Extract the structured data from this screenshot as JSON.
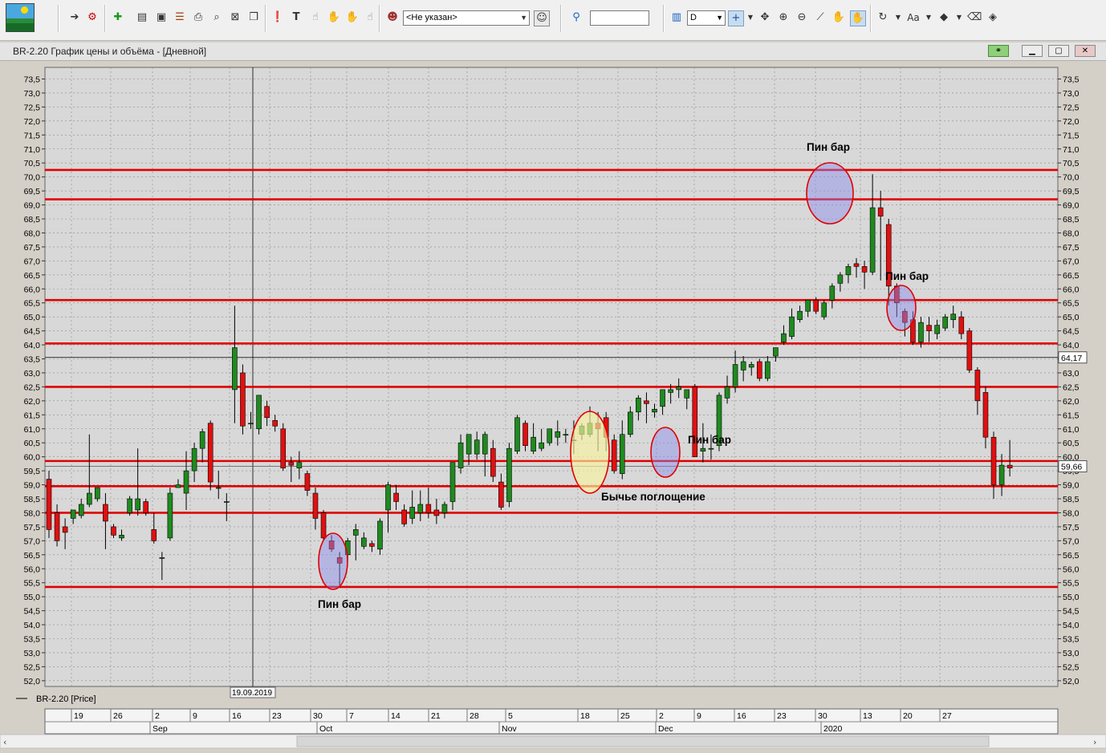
{
  "toolbar": {
    "instrument_select": "<Не указан>",
    "period_select": "D",
    "icons": [
      "logo-icon",
      "arrow-right-icon",
      "chart-settings-icon",
      "add-window-icon",
      "window-icon",
      "window-icon",
      "table-icon",
      "print-icon",
      "search-icon",
      "close-window-icon",
      "copy-icon",
      "info-icon",
      "text-tool-icon",
      "hand-icon",
      "hand-icon",
      "hand-icon",
      "hand-icon",
      "user-icon",
      "user-search-icon",
      "search-icon",
      "chart-type-icon",
      "crosshair-icon",
      "move-icon",
      "zoom-in-icon",
      "zoom-out-icon",
      "ruler-icon",
      "pan-icon",
      "pan-icon",
      "rotate-icon",
      "font-icon",
      "color-icon",
      "eraser-icon",
      "layers-icon"
    ]
  },
  "window": {
    "title": "BR-2.20 График цены и объёма - [Дневной]"
  },
  "chart_data": {
    "type": "candlestick",
    "instrument": "BR-2.20 [Price]",
    "y_ticks": [
      "73,5",
      "73,0",
      "72,5",
      "72,0",
      "71,5",
      "71,0",
      "70,5",
      "70,0",
      "69,5",
      "69,0",
      "68,5",
      "68,0",
      "67,5",
      "67,0",
      "66,5",
      "66,0",
      "65,5",
      "65,0",
      "64,5",
      "64,0",
      "63,5",
      "63,0",
      "62,5",
      "62,0",
      "61,5",
      "61,0",
      "60,5",
      "60,0",
      "59,5",
      "59,0",
      "58,5",
      "58,0",
      "57,5",
      "57,0",
      "56,5",
      "56,0",
      "55,5",
      "55,0",
      "54,5",
      "54,0",
      "53,5",
      "53,0",
      "52,5",
      "52,0"
    ],
    "ylim": [
      51.8,
      73.7
    ],
    "x_day_ticks": [
      "19",
      "26",
      "2",
      "9",
      "16",
      "23",
      "30",
      "7",
      "14",
      "21",
      "28",
      "5",
      "18",
      "25",
      "2",
      "9",
      "16",
      "23",
      "30",
      "13",
      "20",
      "27"
    ],
    "x_month_labels": [
      "Sep",
      "Oct",
      "Nov",
      "Dec",
      "2020"
    ],
    "crosshair_date": "19.09.2019",
    "price_labels": [
      "64,17",
      "59,66"
    ],
    "support_resistance_levels": [
      70.25,
      69.2,
      65.6,
      64.05,
      62.5,
      59.85,
      58.95,
      58.0,
      55.35
    ],
    "crosshair_price_level": 63.55,
    "current_price_level": 59.66,
    "annotations": [
      "Пин бар",
      "Пин бар",
      "Пин бар",
      "Пин бар",
      "Бычье поглощение"
    ],
    "candles": [
      {
        "o": 59.2,
        "h": 59.5,
        "l": 57.1,
        "c": 57.4
      },
      {
        "o": 58.0,
        "h": 58.3,
        "l": 56.8,
        "c": 57.0
      },
      {
        "o": 57.5,
        "h": 57.8,
        "l": 56.7,
        "c": 57.3
      },
      {
        "o": 57.8,
        "h": 58.1,
        "l": 57.6,
        "c": 58.1
      },
      {
        "o": 57.9,
        "h": 58.5,
        "l": 57.8,
        "c": 58.3
      },
      {
        "o": 58.3,
        "h": 60.8,
        "l": 58.2,
        "c": 58.7
      },
      {
        "o": 58.5,
        "h": 58.9,
        "l": 58.4,
        "c": 58.9
      },
      {
        "o": 58.3,
        "h": 58.7,
        "l": 56.7,
        "c": 57.7
      },
      {
        "o": 57.5,
        "h": 57.6,
        "l": 57.1,
        "c": 57.2
      },
      {
        "o": 57.1,
        "h": 57.4,
        "l": 57.0,
        "c": 57.2
      },
      {
        "o": 58.0,
        "h": 58.6,
        "l": 57.9,
        "c": 58.5
      },
      {
        "o": 58.1,
        "h": 60.3,
        "l": 57.9,
        "c": 58.5
      },
      {
        "o": 58.4,
        "h": 58.5,
        "l": 57.9,
        "c": 58.0
      },
      {
        "o": 57.4,
        "h": 58.0,
        "l": 56.9,
        "c": 57.0
      },
      {
        "o": 56.4,
        "h": 56.6,
        "l": 55.6,
        "c": 56.4
      },
      {
        "o": 57.1,
        "h": 58.9,
        "l": 57.0,
        "c": 58.7
      },
      {
        "o": 58.9,
        "h": 59.2,
        "l": 58.9,
        "c": 59.0
      },
      {
        "o": 58.7,
        "h": 60.2,
        "l": 58.1,
        "c": 59.5
      },
      {
        "o": 59.5,
        "h": 60.5,
        "l": 59.1,
        "c": 60.3
      },
      {
        "o": 60.3,
        "h": 61.0,
        "l": 59.8,
        "c": 60.9
      },
      {
        "o": 61.2,
        "h": 61.3,
        "l": 58.8,
        "c": 59.1
      },
      {
        "o": 58.9,
        "h": 59.5,
        "l": 58.5,
        "c": 58.9
      },
      {
        "o": 58.4,
        "h": 58.7,
        "l": 57.7,
        "c": 58.4
      },
      {
        "o": 62.4,
        "h": 65.4,
        "l": 61.2,
        "c": 63.9
      },
      {
        "o": 63.0,
        "h": 63.3,
        "l": 60.8,
        "c": 61.1
      },
      {
        "o": 61.2,
        "h": 61.6,
        "l": 61.0,
        "c": 61.2
      },
      {
        "o": 61.0,
        "h": 62.2,
        "l": 60.8,
        "c": 62.2
      },
      {
        "o": 61.8,
        "h": 62.0,
        "l": 61.1,
        "c": 61.4
      },
      {
        "o": 61.3,
        "h": 61.5,
        "l": 60.9,
        "c": 61.1
      },
      {
        "o": 61.0,
        "h": 61.2,
        "l": 59.5,
        "c": 59.6
      },
      {
        "o": 59.8,
        "h": 60.0,
        "l": 59.1,
        "c": 59.7
      },
      {
        "o": 59.6,
        "h": 60.2,
        "l": 59.2,
        "c": 59.8
      },
      {
        "o": 59.4,
        "h": 59.5,
        "l": 58.6,
        "c": 58.8
      },
      {
        "o": 58.7,
        "h": 58.9,
        "l": 57.4,
        "c": 57.8
      },
      {
        "o": 58.0,
        "h": 58.1,
        "l": 57.0,
        "c": 57.1
      },
      {
        "o": 57.0,
        "h": 57.2,
        "l": 56.6,
        "c": 56.7
      },
      {
        "o": 56.4,
        "h": 56.6,
        "l": 55.4,
        "c": 56.2
      },
      {
        "o": 56.5,
        "h": 57.1,
        "l": 56.3,
        "c": 57.0
      },
      {
        "o": 57.2,
        "h": 57.6,
        "l": 56.3,
        "c": 57.4
      },
      {
        "o": 56.8,
        "h": 57.3,
        "l": 56.7,
        "c": 57.1
      },
      {
        "o": 56.9,
        "h": 57.0,
        "l": 56.6,
        "c": 56.8
      },
      {
        "o": 56.7,
        "h": 57.8,
        "l": 56.5,
        "c": 57.7
      },
      {
        "o": 58.1,
        "h": 59.1,
        "l": 57.3,
        "c": 59.0
      },
      {
        "o": 58.7,
        "h": 59.0,
        "l": 58.1,
        "c": 58.4
      },
      {
        "o": 58.1,
        "h": 58.3,
        "l": 57.5,
        "c": 57.6
      },
      {
        "o": 57.8,
        "h": 58.8,
        "l": 57.6,
        "c": 58.2
      },
      {
        "o": 58.0,
        "h": 58.8,
        "l": 57.7,
        "c": 58.3
      },
      {
        "o": 58.3,
        "h": 58.9,
        "l": 57.8,
        "c": 58.0
      },
      {
        "o": 58.1,
        "h": 58.5,
        "l": 57.6,
        "c": 57.9
      },
      {
        "o": 58.0,
        "h": 58.4,
        "l": 57.8,
        "c": 58.3
      },
      {
        "o": 58.4,
        "h": 59.8,
        "l": 58.1,
        "c": 59.8
      },
      {
        "o": 59.6,
        "h": 60.8,
        "l": 59.4,
        "c": 60.5
      },
      {
        "o": 60.1,
        "h": 60.8,
        "l": 59.7,
        "c": 60.8
      },
      {
        "o": 60.1,
        "h": 60.9,
        "l": 59.9,
        "c": 60.6
      },
      {
        "o": 60.1,
        "h": 60.9,
        "l": 59.3,
        "c": 60.8
      },
      {
        "o": 60.3,
        "h": 60.6,
        "l": 59.1,
        "c": 59.3
      },
      {
        "o": 59.1,
        "h": 59.4,
        "l": 58.1,
        "c": 58.2
      },
      {
        "o": 58.4,
        "h": 60.5,
        "l": 58.2,
        "c": 60.3
      },
      {
        "o": 60.2,
        "h": 61.5,
        "l": 60.1,
        "c": 61.4
      },
      {
        "o": 61.2,
        "h": 61.3,
        "l": 60.2,
        "c": 60.4
      },
      {
        "o": 60.2,
        "h": 61.2,
        "l": 60.1,
        "c": 60.7
      },
      {
        "o": 60.3,
        "h": 61.0,
        "l": 60.2,
        "c": 60.5
      },
      {
        "o": 60.5,
        "h": 61.0,
        "l": 60.4,
        "c": 61.0
      },
      {
        "o": 60.7,
        "h": 61.3,
        "l": 60.4,
        "c": 60.9
      },
      {
        "o": 60.8,
        "h": 61.0,
        "l": 60.5,
        "c": 60.8
      },
      {
        "o": 60.6,
        "h": 61.3,
        "l": 60.1,
        "c": 60.6
      },
      {
        "o": 60.8,
        "h": 61.2,
        "l": 60.6,
        "c": 61.1
      },
      {
        "o": 60.8,
        "h": 61.8,
        "l": 60.7,
        "c": 61.2
      },
      {
        "o": 61.2,
        "h": 61.6,
        "l": 60.2,
        "c": 61.0
      },
      {
        "o": 61.4,
        "h": 61.6,
        "l": 60.2,
        "c": 60.7
      },
      {
        "o": 60.6,
        "h": 60.8,
        "l": 59.4,
        "c": 59.5
      },
      {
        "o": 59.4,
        "h": 61.3,
        "l": 59.2,
        "c": 60.8
      },
      {
        "o": 60.8,
        "h": 61.8,
        "l": 60.7,
        "c": 61.6
      },
      {
        "o": 61.6,
        "h": 62.2,
        "l": 61.3,
        "c": 62.1
      },
      {
        "o": 62.0,
        "h": 62.3,
        "l": 61.2,
        "c": 61.9
      },
      {
        "o": 61.6,
        "h": 61.9,
        "l": 61.4,
        "c": 61.7
      },
      {
        "o": 61.8,
        "h": 62.4,
        "l": 61.5,
        "c": 62.4
      },
      {
        "o": 62.3,
        "h": 62.6,
        "l": 61.9,
        "c": 62.4
      },
      {
        "o": 62.4,
        "h": 62.8,
        "l": 62.1,
        "c": 62.5
      },
      {
        "o": 62.1,
        "h": 62.4,
        "l": 61.7,
        "c": 62.4
      },
      {
        "o": 62.5,
        "h": 62.6,
        "l": 60.2,
        "c": 60.0
      },
      {
        "o": 60.2,
        "h": 61.2,
        "l": 59.8,
        "c": 60.3
      },
      {
        "o": 60.3,
        "h": 60.8,
        "l": 59.9,
        "c": 60.3
      },
      {
        "o": 60.4,
        "h": 62.3,
        "l": 60.2,
        "c": 62.2
      },
      {
        "o": 62.1,
        "h": 62.9,
        "l": 61.9,
        "c": 62.5
      },
      {
        "o": 62.5,
        "h": 63.8,
        "l": 62.3,
        "c": 63.3
      },
      {
        "o": 63.1,
        "h": 63.6,
        "l": 62.7,
        "c": 63.4
      },
      {
        "o": 63.2,
        "h": 63.4,
        "l": 62.9,
        "c": 63.3
      },
      {
        "o": 63.4,
        "h": 63.5,
        "l": 62.7,
        "c": 62.8
      },
      {
        "o": 62.8,
        "h": 63.6,
        "l": 62.7,
        "c": 63.4
      },
      {
        "o": 63.6,
        "h": 63.9,
        "l": 63.4,
        "c": 63.9
      },
      {
        "o": 64.1,
        "h": 64.7,
        "l": 64.0,
        "c": 64.4
      },
      {
        "o": 64.3,
        "h": 65.3,
        "l": 64.2,
        "c": 65.0
      },
      {
        "o": 64.9,
        "h": 65.4,
        "l": 64.8,
        "c": 65.2
      },
      {
        "o": 65.2,
        "h": 65.6,
        "l": 65.0,
        "c": 65.6
      },
      {
        "o": 65.6,
        "h": 65.7,
        "l": 65.1,
        "c": 65.2
      },
      {
        "o": 65.0,
        "h": 65.6,
        "l": 64.9,
        "c": 65.5
      },
      {
        "o": 65.6,
        "h": 66.2,
        "l": 65.3,
        "c": 66.1
      },
      {
        "o": 66.2,
        "h": 66.6,
        "l": 65.9,
        "c": 66.5
      },
      {
        "o": 66.5,
        "h": 66.9,
        "l": 66.2,
        "c": 66.8
      },
      {
        "o": 66.9,
        "h": 67.1,
        "l": 66.4,
        "c": 66.8
      },
      {
        "o": 66.8,
        "h": 67.0,
        "l": 66.0,
        "c": 66.6
      },
      {
        "o": 66.6,
        "h": 70.1,
        "l": 66.5,
        "c": 68.9
      },
      {
        "o": 68.9,
        "h": 69.5,
        "l": 66.3,
        "c": 68.6
      },
      {
        "o": 68.3,
        "h": 68.5,
        "l": 65.4,
        "c": 66.1
      },
      {
        "o": 66.1,
        "h": 66.2,
        "l": 65.0,
        "c": 65.5
      },
      {
        "o": 65.2,
        "h": 65.3,
        "l": 64.3,
        "c": 64.8
      },
      {
        "o": 64.9,
        "h": 65.2,
        "l": 64.0,
        "c": 64.1
      },
      {
        "o": 64.1,
        "h": 65.0,
        "l": 63.9,
        "c": 64.8
      },
      {
        "o": 64.7,
        "h": 65.0,
        "l": 64.1,
        "c": 64.5
      },
      {
        "o": 64.4,
        "h": 64.9,
        "l": 64.2,
        "c": 64.7
      },
      {
        "o": 64.6,
        "h": 65.1,
        "l": 64.5,
        "c": 65.0
      },
      {
        "o": 64.9,
        "h": 65.4,
        "l": 64.6,
        "c": 65.1
      },
      {
        "o": 65.0,
        "h": 65.2,
        "l": 64.2,
        "c": 64.4
      },
      {
        "o": 64.5,
        "h": 64.6,
        "l": 63.0,
        "c": 63.1
      },
      {
        "o": 63.1,
        "h": 63.2,
        "l": 61.5,
        "c": 62.0
      },
      {
        "o": 62.3,
        "h": 62.5,
        "l": 60.3,
        "c": 60.7
      },
      {
        "o": 60.7,
        "h": 60.9,
        "l": 58.5,
        "c": 59.0
      },
      {
        "o": 59.0,
        "h": 60.1,
        "l": 58.6,
        "c": 59.7
      },
      {
        "o": 59.7,
        "h": 60.6,
        "l": 59.3,
        "c": 59.6
      }
    ]
  }
}
